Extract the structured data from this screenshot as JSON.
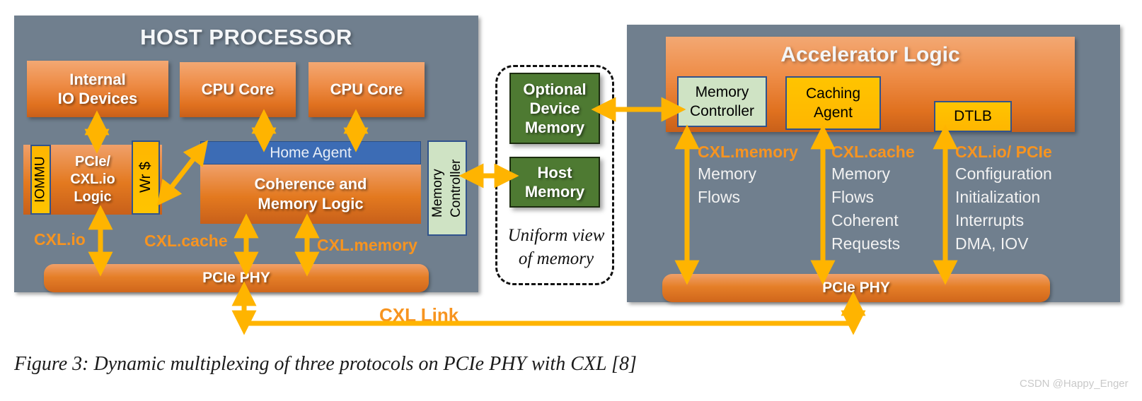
{
  "figure": {
    "caption": "Figure 3: Dynamic multiplexing of three protocols on PCIe PHY with CXL [8]",
    "watermark": "CSDN @Happy_Enger"
  },
  "host": {
    "title": "HOST PROCESSOR",
    "internal_io": "Internal\nIO Devices",
    "cpu_core_1": "CPU Core",
    "cpu_core_2": "CPU Core",
    "iommu": "IOMMU",
    "pcie_cxlio_logic": "PCIe/\nCXL.io\nLogic",
    "wr_cache": "Wr $",
    "home_agent": "Home Agent",
    "coherence_memory_logic": "Coherence and\nMemory Logic",
    "memory_controller": "Memory\nController",
    "protocol_labels": {
      "cxl_io": "CXL.io",
      "cxl_cache": "CXL.cache",
      "cxl_memory": "CXL.memory"
    },
    "phy": "PCIe PHY"
  },
  "memory_view": {
    "optional_device_memory": "Optional\nDevice\nMemory",
    "host_memory": "Host\nMemory",
    "note": "Uniform view\nof memory"
  },
  "accelerator": {
    "title": "Accelerator Logic",
    "memory_controller": "Memory\nController",
    "caching_agent": "Caching\nAgent",
    "dtlb": "DTLB",
    "phy": "PCIe PHY",
    "columns": [
      {
        "protocol": "CXL.memory",
        "lines": "Memory\nFlows"
      },
      {
        "protocol": "CXL.cache",
        "lines": "Memory\nFlows\nCoherent\nRequests"
      },
      {
        "protocol": "CXL.io/ PCIe",
        "lines": "Configuration\nInitialization\nInterrupts\nDMA, IOV"
      }
    ]
  },
  "link": {
    "label": "CXL Link"
  },
  "colors": {
    "panel": "#707F8E",
    "orange": "#E3791F",
    "orange_label": "#F79420",
    "green": "#4E7A32",
    "yellow": "#FFBE00",
    "mint": "#CFE3C4",
    "blue": "#3C6CB5",
    "arrow": "#FFB400"
  }
}
